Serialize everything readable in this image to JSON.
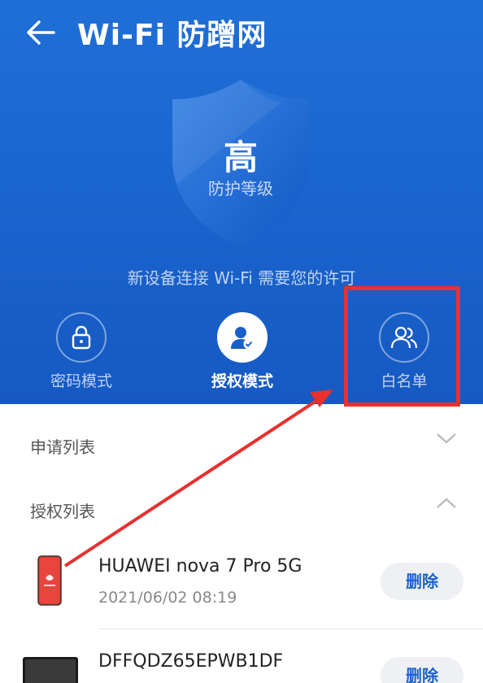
{
  "header": {
    "title": "Wi-Fi 防蹭网",
    "back_icon": "back-arrow-icon"
  },
  "protection": {
    "level": "高",
    "level_label": "防护等级",
    "notice": "新设备连接 Wi-Fi 需要您的许可"
  },
  "modes": [
    {
      "label": "密码模式",
      "icon": "lock-icon",
      "active": false
    },
    {
      "label": "授权模式",
      "icon": "user-check-icon",
      "active": true
    },
    {
      "label": "白名单",
      "icon": "users-icon",
      "active": false
    }
  ],
  "sections": {
    "requests": "申请列表",
    "authorized": "授权列表"
  },
  "devices": [
    {
      "name": "HUAWEI nova 7 Pro 5G",
      "time": "2021/06/02 08:19",
      "delete_label": "删除"
    },
    {
      "name": "DFFQDZ65EPWB1DF",
      "delete_label": "删除"
    }
  ],
  "colors": {
    "accent": "#1a63cc",
    "highlight": "#e8302f",
    "header_bg": "#1f6fd6"
  }
}
